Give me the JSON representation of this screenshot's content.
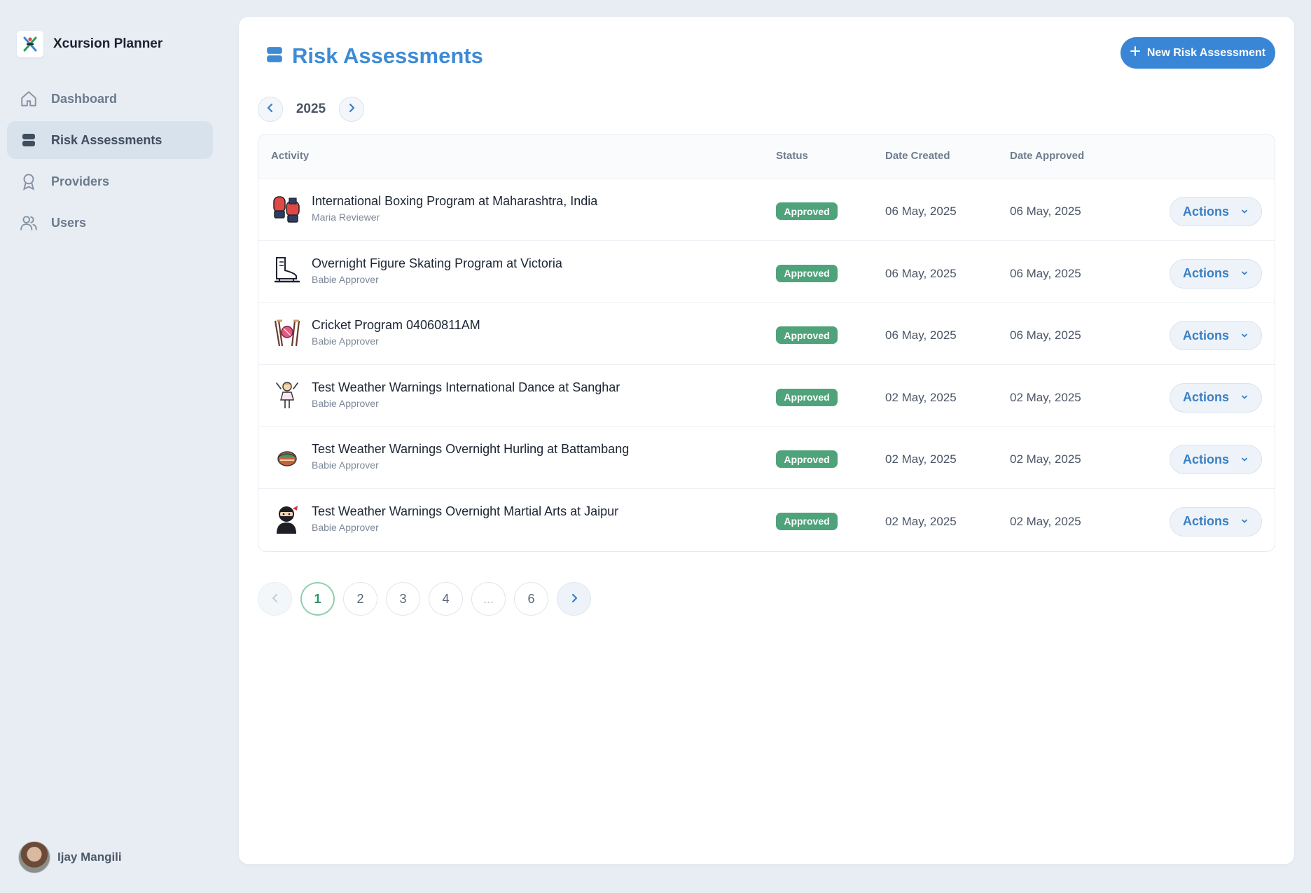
{
  "app": {
    "title": "Xcursion Planner"
  },
  "sidebar": {
    "items": [
      {
        "label": "Dashboard",
        "icon": "home-icon",
        "active": false
      },
      {
        "label": "Risk Assessments",
        "icon": "stack-icon",
        "active": true
      },
      {
        "label": "Providers",
        "icon": "providers-icon",
        "active": false
      },
      {
        "label": "Users",
        "icon": "users-icon",
        "active": false
      }
    ],
    "user": {
      "name": "Ijay Mangili"
    }
  },
  "header": {
    "title": "Risk Assessments",
    "new_button_label": "New Risk Assessment"
  },
  "year_filter": {
    "year": "2025"
  },
  "table": {
    "columns": {
      "activity": "Activity",
      "status": "Status",
      "date_created": "Date Created",
      "date_approved": "Date Approved"
    },
    "rows": [
      {
        "title": "International Boxing Program at Maharashtra, India",
        "author": "Maria Reviewer",
        "status": "Approved",
        "date_created": "06 May, 2025",
        "date_approved": "06 May, 2025",
        "actions": "Actions",
        "icon": "boxing-gloves-icon"
      },
      {
        "title": "Overnight Figure Skating Program at Victoria",
        "author": "Babie Approver",
        "status": "Approved",
        "date_created": "06 May, 2025",
        "date_approved": "06 May, 2025",
        "actions": "Actions",
        "icon": "ice-skate-icon"
      },
      {
        "title": "Cricket Program 04060811AM",
        "author": "Babie Approver",
        "status": "Approved",
        "date_created": "06 May, 2025",
        "date_approved": "06 May, 2025",
        "actions": "Actions",
        "icon": "cricket-icon"
      },
      {
        "title": "Test Weather Warnings International Dance at Sanghar",
        "author": "Babie Approver",
        "status": "Approved",
        "date_created": "02 May, 2025",
        "date_approved": "02 May, 2025",
        "actions": "Actions",
        "icon": "dancer-icon"
      },
      {
        "title": "Test Weather Warnings Overnight Hurling at Battambang",
        "author": "Babie Approver",
        "status": "Approved",
        "date_created": "02 May, 2025",
        "date_approved": "02 May, 2025",
        "actions": "Actions",
        "icon": "hurling-icon"
      },
      {
        "title": "Test Weather Warnings Overnight Martial Arts at Jaipur",
        "author": "Babie Approver",
        "status": "Approved",
        "date_created": "02 May, 2025",
        "date_approved": "02 May, 2025",
        "actions": "Actions",
        "icon": "ninja-icon"
      }
    ]
  },
  "pagination": {
    "pages": [
      "1",
      "2",
      "3",
      "4",
      "...",
      "6"
    ],
    "current": "1"
  },
  "colors": {
    "accent": "#3a86d6",
    "approved": "#4fa37a",
    "background": "#e8edf4"
  }
}
